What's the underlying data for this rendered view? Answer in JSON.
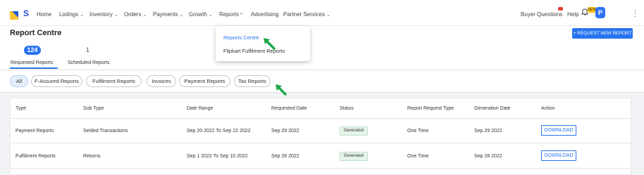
{
  "nav": {
    "brand": "S",
    "items": [
      {
        "label": "Home",
        "chevron": ""
      },
      {
        "label": "Listings",
        "chevron": "⌄"
      },
      {
        "label": "Inventory",
        "chevron": "⌄"
      },
      {
        "label": "Orders",
        "chevron": "⌄"
      },
      {
        "label": "Payments",
        "chevron": "⌄"
      },
      {
        "label": "Growth",
        "chevron": "⌄"
      },
      {
        "label": "Reports",
        "chevron": "^"
      },
      {
        "label": "Advertising",
        "chevron": ""
      },
      {
        "label": "Partner Services",
        "chevron": "⌄"
      }
    ],
    "buyer_questions": "Buyer Questions",
    "help": "Help",
    "new_badge": "NEW",
    "avatar_letter": "P",
    "menu_icon": "kebab-icon"
  },
  "page": {
    "title": "Report Centre",
    "request_button": "+ REQUEST NEW REPORT",
    "requested_count": "124",
    "scheduled_count": "1",
    "tabs": [
      "Requested Reports",
      "Scheduled Reports"
    ]
  },
  "filters": [
    "All",
    "F-Assured Reports",
    "Fulfilment Reports",
    "Invoices",
    "Payment Reports",
    "Tax Reports"
  ],
  "table": {
    "headers": [
      "Type",
      "Sub Type",
      "Date Range",
      "Requested Date",
      "Status",
      "Report Request Type",
      "Generation Date",
      "Action"
    ],
    "rows": [
      {
        "type": "Payment Reports",
        "sub_type": "Settled Transactions",
        "date_range": "Sep 20 2022 To Sep 22 2022",
        "requested_date": "Sep 29 2022",
        "status": "Generated",
        "request_type": "One Time",
        "generation_date": "Sep 29 2022",
        "action": "DOWNLOAD"
      },
      {
        "type": "Fulfilment Reports",
        "sub_type": "Returns",
        "date_range": "Sep 1 2022 To Sep 10 2022",
        "requested_date": "Sep 28 2022",
        "status": "Generated",
        "request_type": "One Time",
        "generation_date": "Sep 28 2022",
        "action": "DOWNLOAD"
      }
    ]
  },
  "reports_menu": {
    "items": [
      "Reports Centre",
      "Flipkart Fulfilment Reports"
    ]
  },
  "colors": {
    "accent": "#2874f0",
    "arrow": "#1ea84b",
    "status_bg": "#e6f4ea"
  }
}
